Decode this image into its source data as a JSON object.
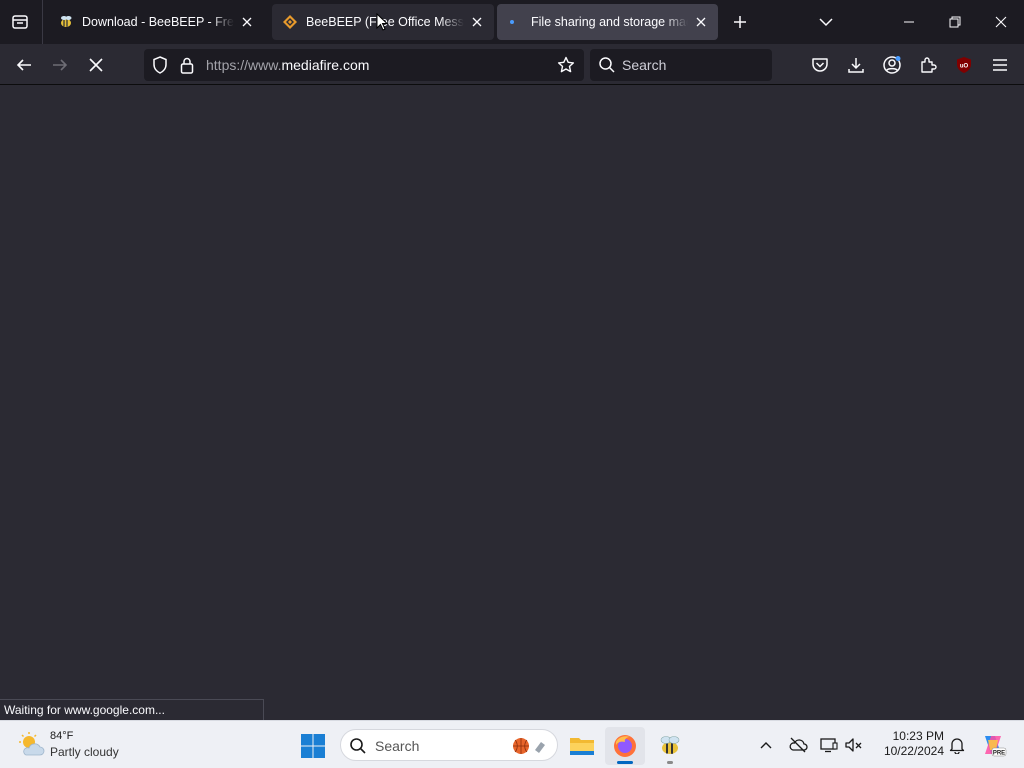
{
  "browser": {
    "tabs": [
      {
        "title": "Download - BeeBEEP - Free Office Messenger",
        "favicon": "bee-icon",
        "active": false
      },
      {
        "title": "BeeBEEP (Free Office Messenger)",
        "favicon": "beebeep-diamond-icon",
        "active": false
      },
      {
        "title": "File sharing and storage made simple",
        "favicon": "loading-dot-icon",
        "active": true
      }
    ],
    "url": {
      "scheme": "https://www.",
      "host": "mediafire.com"
    },
    "search": {
      "placeholder": "Search"
    },
    "status_text": "Waiting for www.google.com..."
  },
  "taskbar": {
    "weather": {
      "temp": "84°F",
      "desc": "Partly cloudy"
    },
    "search": {
      "placeholder": "Search"
    },
    "clock": {
      "time": "10:23 PM",
      "date": "10/22/2024"
    }
  },
  "colors": {
    "chrome_bg": "#1c1b22",
    "toolbar_bg": "#2b2a33",
    "active_tab": "#42414d",
    "accent": "#0067c0"
  }
}
